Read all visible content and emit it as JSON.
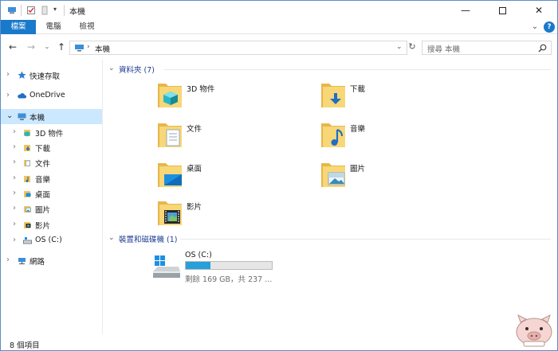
{
  "window": {
    "title": "本機",
    "accent": "#1979ca",
    "controls": [
      "minimize-icon",
      "maximize-icon",
      "close-icon"
    ]
  },
  "ribbon": {
    "tabs": [
      "檔案",
      "電腦",
      "檢視"
    ]
  },
  "address": {
    "path": "本機",
    "search_placeholder": "搜尋 本機"
  },
  "sidebar": {
    "items": [
      {
        "label": "快速存取",
        "icon": "star-icon"
      },
      {
        "label": "OneDrive",
        "icon": "cloud-icon"
      },
      {
        "label": "本機",
        "icon": "computer-icon"
      },
      {
        "label": "3D 物件",
        "icon": "3d-objects-icon"
      },
      {
        "label": "下載",
        "icon": "downloads-icon"
      },
      {
        "label": "文件",
        "icon": "documents-icon"
      },
      {
        "label": "音樂",
        "icon": "music-icon"
      },
      {
        "label": "桌面",
        "icon": "desktop-icon"
      },
      {
        "label": "圖片",
        "icon": "pictures-icon"
      },
      {
        "label": "影片",
        "icon": "videos-icon"
      },
      {
        "label": "OS (C:)",
        "icon": "drive-icon"
      },
      {
        "label": "網路",
        "icon": "network-icon"
      }
    ]
  },
  "content": {
    "folders_group": "資料夾 (7)",
    "folders": [
      {
        "label": "3D 物件",
        "icon": "3d-objects-icon"
      },
      {
        "label": "下載",
        "icon": "downloads-icon"
      },
      {
        "label": "文件",
        "icon": "documents-icon"
      },
      {
        "label": "音樂",
        "icon": "music-icon"
      },
      {
        "label": "桌面",
        "icon": "desktop-icon"
      },
      {
        "label": "圖片",
        "icon": "pictures-icon"
      },
      {
        "label": "影片",
        "icon": "videos-icon"
      }
    ],
    "devices_group": "裝置和磁碟機 (1)",
    "drive": {
      "name": "OS (C:)",
      "free": "剩餘 169 GB，共 237 ...",
      "used_fraction": 0.29
    }
  },
  "status": {
    "items_count": "8 個項目"
  }
}
